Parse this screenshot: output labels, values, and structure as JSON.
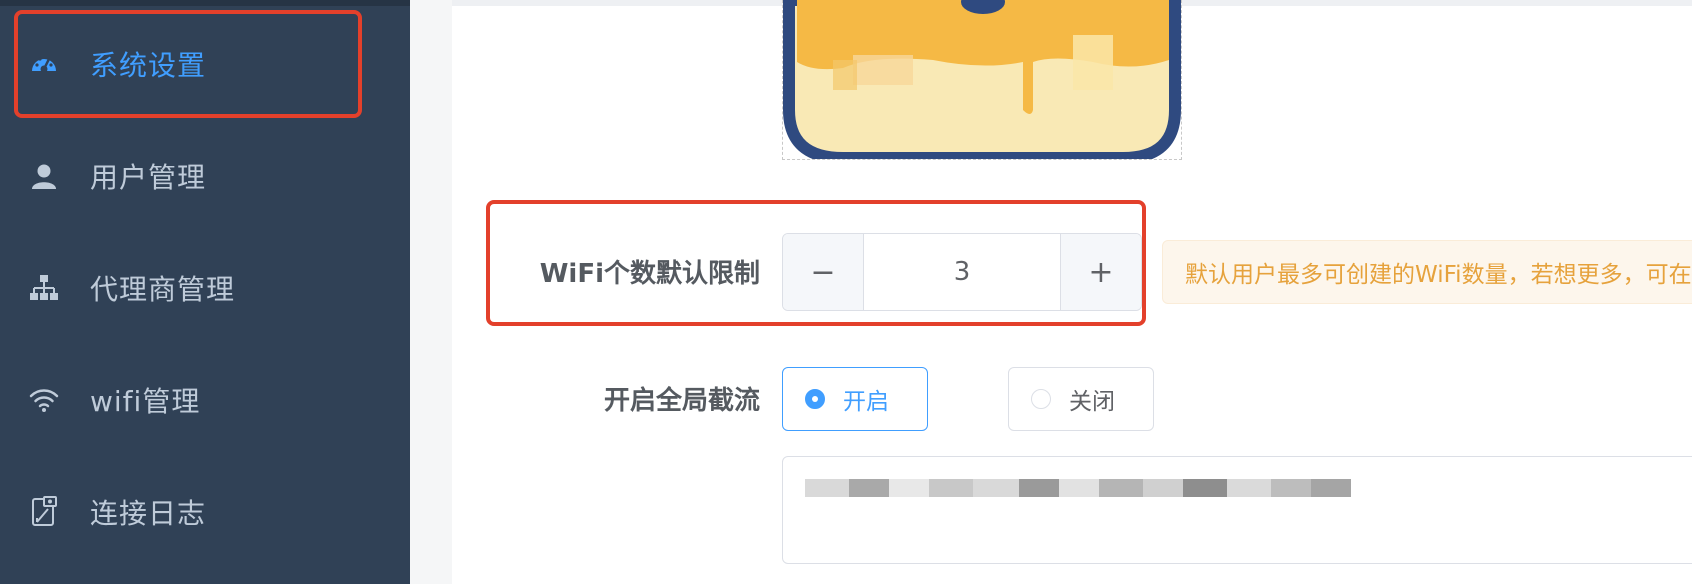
{
  "sidebar": {
    "items": [
      {
        "label": "系统设置",
        "icon": "dashboard-icon",
        "active": true
      },
      {
        "label": "用户管理",
        "icon": "user-icon",
        "active": false
      },
      {
        "label": "代理商管理",
        "icon": "org-tree-icon",
        "active": false
      },
      {
        "label": "wifi管理",
        "icon": "wifi-icon",
        "active": false
      },
      {
        "label": "连接日志",
        "icon": "log-icon",
        "active": false
      }
    ]
  },
  "form": {
    "wifi_limit": {
      "label": "WiFi个数默认限制",
      "value": "3",
      "minus": "−",
      "plus": "+",
      "hint": "默认用户最多可创建的WiFi数量，若想更多，可在"
    },
    "global_intercept": {
      "label": "开启全局截流",
      "options": [
        {
          "label": "开启",
          "checked": true
        },
        {
          "label": "关闭",
          "checked": false
        }
      ]
    }
  },
  "colors": {
    "sidebar_bg": "#304156",
    "active": "#409eff",
    "highlight": "#e3402b",
    "warning": "#e6a23c"
  }
}
